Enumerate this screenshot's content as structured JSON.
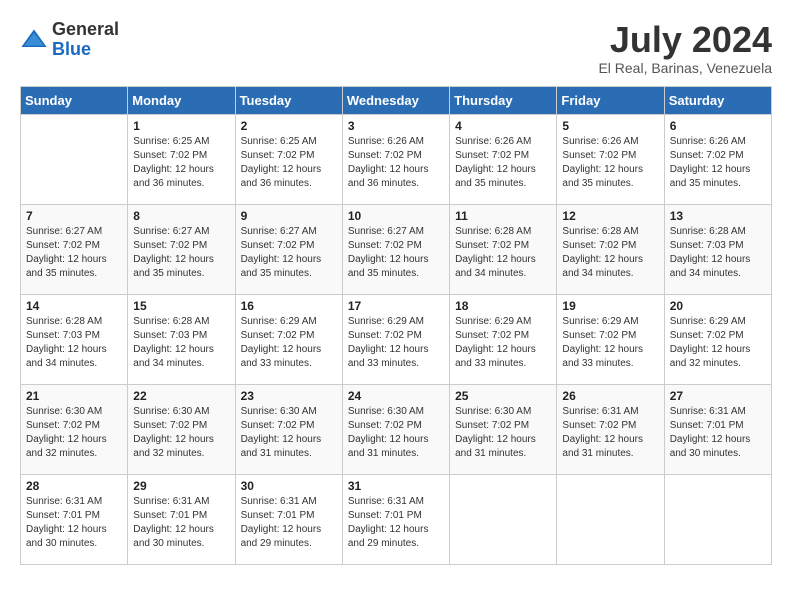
{
  "header": {
    "logo_general": "General",
    "logo_blue": "Blue",
    "month_title": "July 2024",
    "location": "El Real, Barinas, Venezuela"
  },
  "days_of_week": [
    "Sunday",
    "Monday",
    "Tuesday",
    "Wednesday",
    "Thursday",
    "Friday",
    "Saturday"
  ],
  "weeks": [
    [
      {
        "day": "",
        "sunrise": "",
        "sunset": "",
        "daylight": ""
      },
      {
        "day": "1",
        "sunrise": "Sunrise: 6:25 AM",
        "sunset": "Sunset: 7:02 PM",
        "daylight": "Daylight: 12 hours and 36 minutes."
      },
      {
        "day": "2",
        "sunrise": "Sunrise: 6:25 AM",
        "sunset": "Sunset: 7:02 PM",
        "daylight": "Daylight: 12 hours and 36 minutes."
      },
      {
        "day": "3",
        "sunrise": "Sunrise: 6:26 AM",
        "sunset": "Sunset: 7:02 PM",
        "daylight": "Daylight: 12 hours and 36 minutes."
      },
      {
        "day": "4",
        "sunrise": "Sunrise: 6:26 AM",
        "sunset": "Sunset: 7:02 PM",
        "daylight": "Daylight: 12 hours and 35 minutes."
      },
      {
        "day": "5",
        "sunrise": "Sunrise: 6:26 AM",
        "sunset": "Sunset: 7:02 PM",
        "daylight": "Daylight: 12 hours and 35 minutes."
      },
      {
        "day": "6",
        "sunrise": "Sunrise: 6:26 AM",
        "sunset": "Sunset: 7:02 PM",
        "daylight": "Daylight: 12 hours and 35 minutes."
      }
    ],
    [
      {
        "day": "7",
        "sunrise": "Sunrise: 6:27 AM",
        "sunset": "Sunset: 7:02 PM",
        "daylight": "Daylight: 12 hours and 35 minutes."
      },
      {
        "day": "8",
        "sunrise": "Sunrise: 6:27 AM",
        "sunset": "Sunset: 7:02 PM",
        "daylight": "Daylight: 12 hours and 35 minutes."
      },
      {
        "day": "9",
        "sunrise": "Sunrise: 6:27 AM",
        "sunset": "Sunset: 7:02 PM",
        "daylight": "Daylight: 12 hours and 35 minutes."
      },
      {
        "day": "10",
        "sunrise": "Sunrise: 6:27 AM",
        "sunset": "Sunset: 7:02 PM",
        "daylight": "Daylight: 12 hours and 35 minutes."
      },
      {
        "day": "11",
        "sunrise": "Sunrise: 6:28 AM",
        "sunset": "Sunset: 7:02 PM",
        "daylight": "Daylight: 12 hours and 34 minutes."
      },
      {
        "day": "12",
        "sunrise": "Sunrise: 6:28 AM",
        "sunset": "Sunset: 7:02 PM",
        "daylight": "Daylight: 12 hours and 34 minutes."
      },
      {
        "day": "13",
        "sunrise": "Sunrise: 6:28 AM",
        "sunset": "Sunset: 7:03 PM",
        "daylight": "Daylight: 12 hours and 34 minutes."
      }
    ],
    [
      {
        "day": "14",
        "sunrise": "Sunrise: 6:28 AM",
        "sunset": "Sunset: 7:03 PM",
        "daylight": "Daylight: 12 hours and 34 minutes."
      },
      {
        "day": "15",
        "sunrise": "Sunrise: 6:28 AM",
        "sunset": "Sunset: 7:03 PM",
        "daylight": "Daylight: 12 hours and 34 minutes."
      },
      {
        "day": "16",
        "sunrise": "Sunrise: 6:29 AM",
        "sunset": "Sunset: 7:02 PM",
        "daylight": "Daylight: 12 hours and 33 minutes."
      },
      {
        "day": "17",
        "sunrise": "Sunrise: 6:29 AM",
        "sunset": "Sunset: 7:02 PM",
        "daylight": "Daylight: 12 hours and 33 minutes."
      },
      {
        "day": "18",
        "sunrise": "Sunrise: 6:29 AM",
        "sunset": "Sunset: 7:02 PM",
        "daylight": "Daylight: 12 hours and 33 minutes."
      },
      {
        "day": "19",
        "sunrise": "Sunrise: 6:29 AM",
        "sunset": "Sunset: 7:02 PM",
        "daylight": "Daylight: 12 hours and 33 minutes."
      },
      {
        "day": "20",
        "sunrise": "Sunrise: 6:29 AM",
        "sunset": "Sunset: 7:02 PM",
        "daylight": "Daylight: 12 hours and 32 minutes."
      }
    ],
    [
      {
        "day": "21",
        "sunrise": "Sunrise: 6:30 AM",
        "sunset": "Sunset: 7:02 PM",
        "daylight": "Daylight: 12 hours and 32 minutes."
      },
      {
        "day": "22",
        "sunrise": "Sunrise: 6:30 AM",
        "sunset": "Sunset: 7:02 PM",
        "daylight": "Daylight: 12 hours and 32 minutes."
      },
      {
        "day": "23",
        "sunrise": "Sunrise: 6:30 AM",
        "sunset": "Sunset: 7:02 PM",
        "daylight": "Daylight: 12 hours and 31 minutes."
      },
      {
        "day": "24",
        "sunrise": "Sunrise: 6:30 AM",
        "sunset": "Sunset: 7:02 PM",
        "daylight": "Daylight: 12 hours and 31 minutes."
      },
      {
        "day": "25",
        "sunrise": "Sunrise: 6:30 AM",
        "sunset": "Sunset: 7:02 PM",
        "daylight": "Daylight: 12 hours and 31 minutes."
      },
      {
        "day": "26",
        "sunrise": "Sunrise: 6:31 AM",
        "sunset": "Sunset: 7:02 PM",
        "daylight": "Daylight: 12 hours and 31 minutes."
      },
      {
        "day": "27",
        "sunrise": "Sunrise: 6:31 AM",
        "sunset": "Sunset: 7:01 PM",
        "daylight": "Daylight: 12 hours and 30 minutes."
      }
    ],
    [
      {
        "day": "28",
        "sunrise": "Sunrise: 6:31 AM",
        "sunset": "Sunset: 7:01 PM",
        "daylight": "Daylight: 12 hours and 30 minutes."
      },
      {
        "day": "29",
        "sunrise": "Sunrise: 6:31 AM",
        "sunset": "Sunset: 7:01 PM",
        "daylight": "Daylight: 12 hours and 30 minutes."
      },
      {
        "day": "30",
        "sunrise": "Sunrise: 6:31 AM",
        "sunset": "Sunset: 7:01 PM",
        "daylight": "Daylight: 12 hours and 29 minutes."
      },
      {
        "day": "31",
        "sunrise": "Sunrise: 6:31 AM",
        "sunset": "Sunset: 7:01 PM",
        "daylight": "Daylight: 12 hours and 29 minutes."
      },
      {
        "day": "",
        "sunrise": "",
        "sunset": "",
        "daylight": ""
      },
      {
        "day": "",
        "sunrise": "",
        "sunset": "",
        "daylight": ""
      },
      {
        "day": "",
        "sunrise": "",
        "sunset": "",
        "daylight": ""
      }
    ]
  ]
}
